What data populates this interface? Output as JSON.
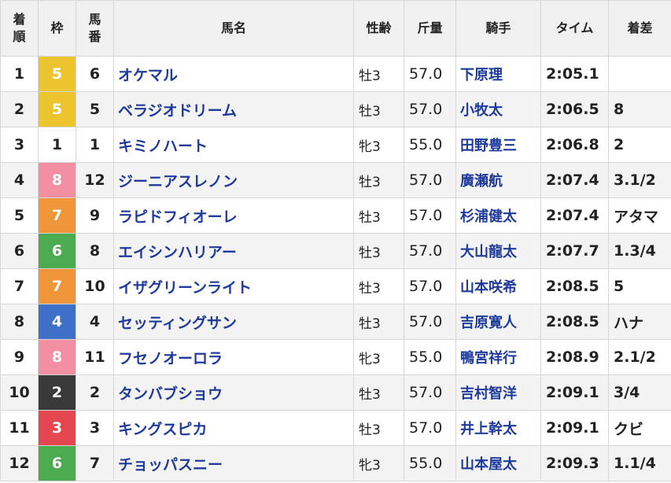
{
  "headers": {
    "rank": [
      "着",
      "順"
    ],
    "waku": "枠",
    "num": [
      "馬",
      "番"
    ],
    "name": "馬名",
    "sex_age": "性齢",
    "kinryo": "斤量",
    "jockey": "騎手",
    "time": "タイム",
    "margin": "着差"
  },
  "waku_colors": {
    "1": {
      "bg": "#ffffff",
      "fg": "#222222"
    },
    "2": {
      "bg": "#3a3a3a",
      "fg": "#ffffff"
    },
    "3": {
      "bg": "#e4474f",
      "fg": "#ffffff"
    },
    "4": {
      "bg": "#3f70c8",
      "fg": "#ffffff"
    },
    "5": {
      "bg": "#ecc52e",
      "fg": "#ffffff"
    },
    "6": {
      "bg": "#4bab4e",
      "fg": "#ffffff"
    },
    "7": {
      "bg": "#f0963a",
      "fg": "#ffffff"
    },
    "8": {
      "bg": "#f28fa2",
      "fg": "#ffffff"
    }
  },
  "rows": [
    {
      "rank": "1",
      "waku": "5",
      "num": "6",
      "name": "オケマル",
      "sex_age": "牡3",
      "kinryo": "57.0",
      "jockey": "下原理",
      "time": "2:05.1",
      "margin": ""
    },
    {
      "rank": "2",
      "waku": "5",
      "num": "5",
      "name": "ベラジオドリーム",
      "sex_age": "牡3",
      "kinryo": "57.0",
      "jockey": "小牧太",
      "time": "2:06.5",
      "margin": "8"
    },
    {
      "rank": "3",
      "waku": "1",
      "num": "1",
      "name": "キミノハート",
      "sex_age": "牝3",
      "kinryo": "55.0",
      "jockey": "田野豊三",
      "time": "2:06.8",
      "margin": "2"
    },
    {
      "rank": "4",
      "waku": "8",
      "num": "12",
      "name": "ジーニアスレノン",
      "sex_age": "牡3",
      "kinryo": "57.0",
      "jockey": "廣瀬航",
      "time": "2:07.4",
      "margin": "3.1/2"
    },
    {
      "rank": "5",
      "waku": "7",
      "num": "9",
      "name": "ラピドフィオーレ",
      "sex_age": "牡3",
      "kinryo": "57.0",
      "jockey": "杉浦健太",
      "time": "2:07.4",
      "margin": "アタマ"
    },
    {
      "rank": "6",
      "waku": "6",
      "num": "8",
      "name": "エイシンハリアー",
      "sex_age": "牡3",
      "kinryo": "57.0",
      "jockey": "大山龍太",
      "time": "2:07.7",
      "margin": "1.3/4"
    },
    {
      "rank": "7",
      "waku": "7",
      "num": "10",
      "name": "イザグリーンライト",
      "sex_age": "牡3",
      "kinryo": "57.0",
      "jockey": "山本咲希",
      "time": "2:08.5",
      "margin": "5"
    },
    {
      "rank": "8",
      "waku": "4",
      "num": "4",
      "name": "セッティングサン",
      "sex_age": "牡3",
      "kinryo": "57.0",
      "jockey": "吉原寛人",
      "time": "2:08.5",
      "margin": "ハナ"
    },
    {
      "rank": "9",
      "waku": "8",
      "num": "11",
      "name": "フセノオーロラ",
      "sex_age": "牝3",
      "kinryo": "55.0",
      "jockey": "鴨宮祥行",
      "time": "2:08.9",
      "margin": "2.1/2"
    },
    {
      "rank": "10",
      "waku": "2",
      "num": "2",
      "name": "タンバブショウ",
      "sex_age": "牡3",
      "kinryo": "57.0",
      "jockey": "吉村智洋",
      "time": "2:09.1",
      "margin": "3/4"
    },
    {
      "rank": "11",
      "waku": "3",
      "num": "3",
      "name": "キングスピカ",
      "sex_age": "牡3",
      "kinryo": "57.0",
      "jockey": "井上幹太",
      "time": "2:09.1",
      "margin": "クビ"
    },
    {
      "rank": "12",
      "waku": "6",
      "num": "7",
      "name": "チョッパスニー",
      "sex_age": "牝3",
      "kinryo": "55.0",
      "jockey": "山本屋太",
      "time": "2:09.3",
      "margin": "1.1/4"
    }
  ]
}
